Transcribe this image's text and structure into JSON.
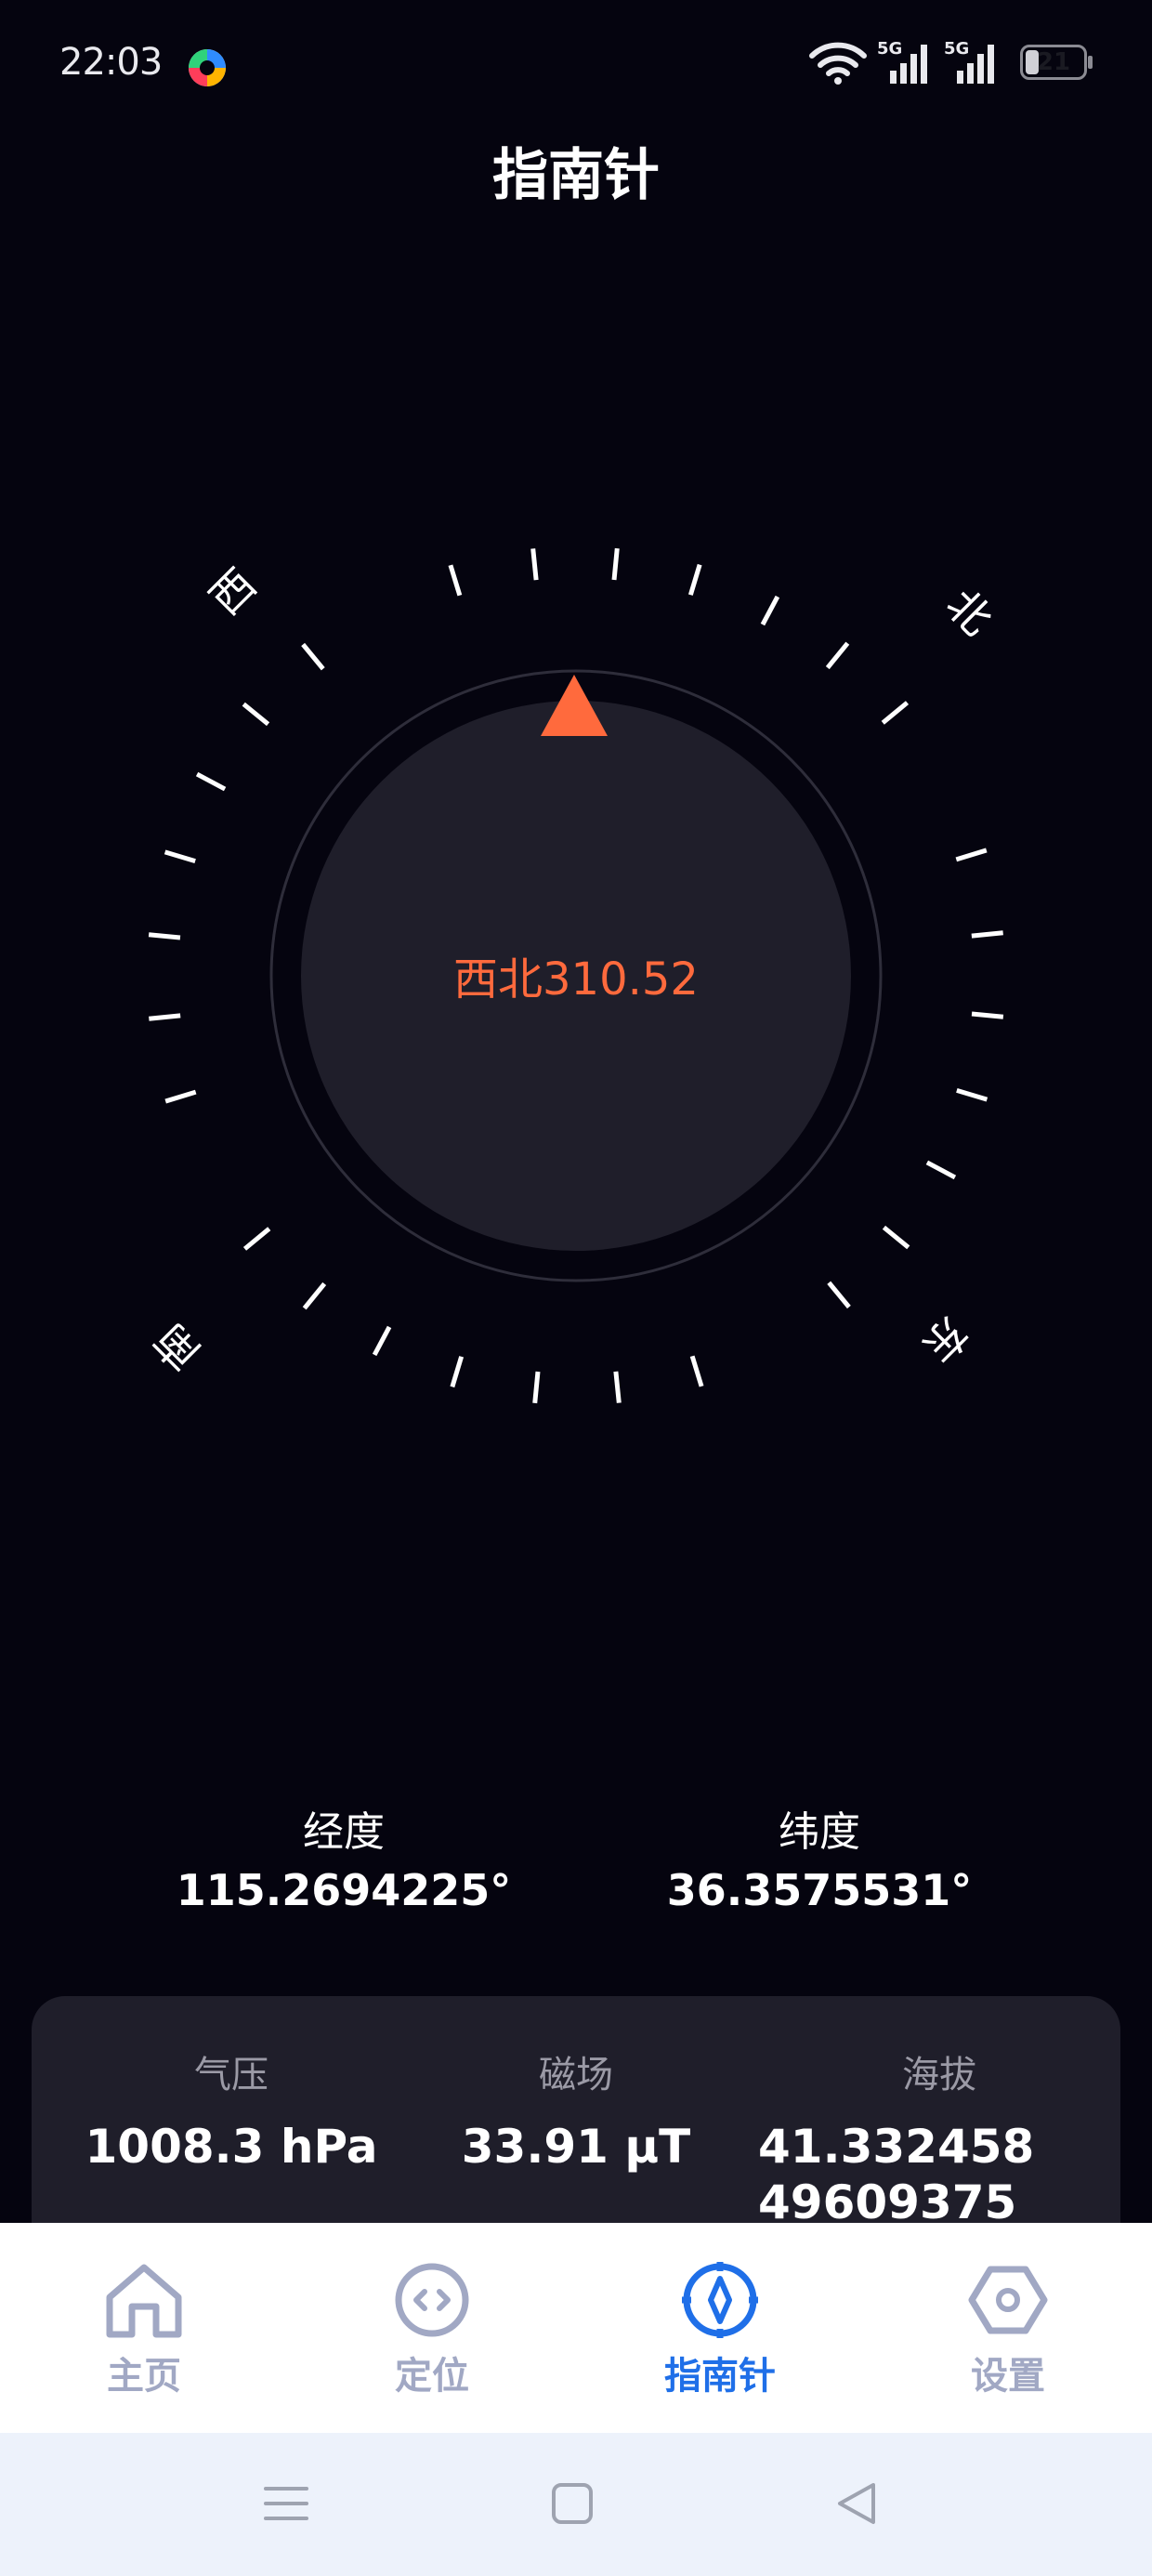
{
  "status_bar": {
    "time": "22:03",
    "signal1_label": "5G",
    "signal2_label": "5G",
    "battery_level": "21"
  },
  "page_title": "指南针",
  "compass": {
    "heading_label": "西北310.52",
    "cardinals": {
      "west": "西",
      "north": "北",
      "south": "南",
      "east": "东"
    },
    "colors": {
      "accent": "#ff6a3d",
      "dial": "#1f1e2a",
      "ring": "#2e2d3a",
      "ticks": "#ffffff"
    }
  },
  "coordinates": {
    "longitude": {
      "label": "经度",
      "value": "115.2694225°"
    },
    "latitude": {
      "label": "纬度",
      "value": "36.3575531°"
    }
  },
  "sensors": {
    "pressure": {
      "label": "气压",
      "value": "1008.3 hPa"
    },
    "magnetic": {
      "label": "磁场",
      "value": "33.91 μT"
    },
    "altitude": {
      "label": "海拔",
      "value": "41.332458 49609375"
    }
  },
  "tabs": [
    {
      "label": "主页",
      "icon": "home-icon",
      "active": false
    },
    {
      "label": "定位",
      "icon": "location-code-icon",
      "active": false
    },
    {
      "label": "指南针",
      "icon": "compass-icon",
      "active": true
    },
    {
      "label": "设置",
      "icon": "settings-hexagon-icon",
      "active": false
    }
  ],
  "nav_bar": {
    "menu": "menu-icon",
    "home": "square-home-icon",
    "back": "back-triangle-icon"
  },
  "colors": {
    "background": "#05040f",
    "active_tab": "#1f6fe8",
    "inactive_tab": "#a1a8c4"
  }
}
